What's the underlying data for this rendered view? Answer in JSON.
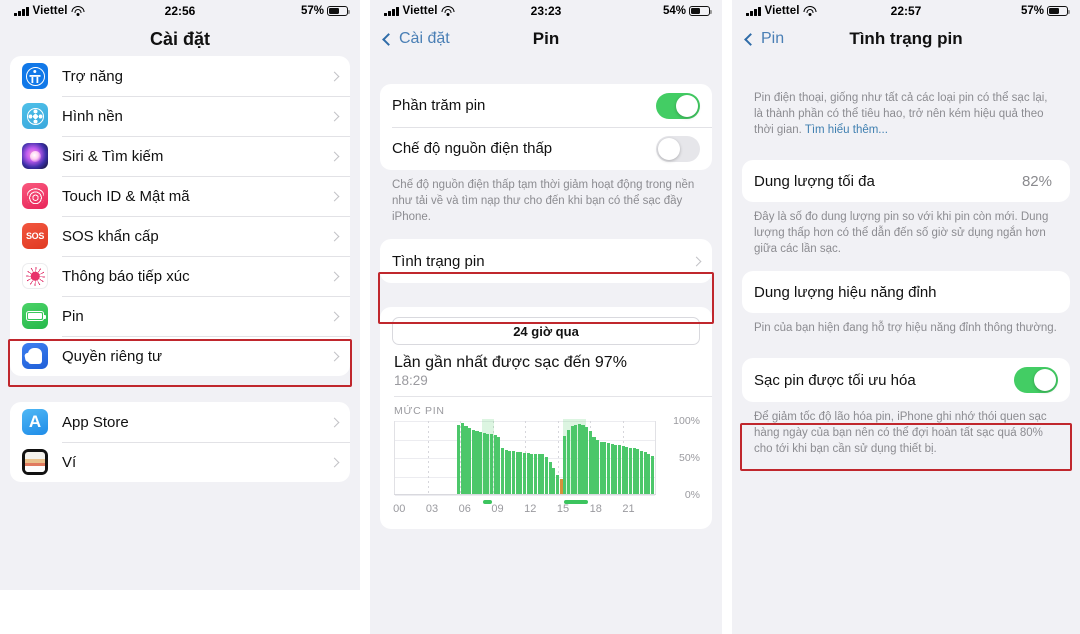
{
  "panel1": {
    "status": {
      "carrier": "Viettel",
      "time": "22:56",
      "battery_pct": "57%",
      "signal_icon": "signal-bars-icon",
      "wifi_icon": "wifi-icon",
      "battery_icon": "battery-icon"
    },
    "nav": {
      "title": "Cài đặt"
    },
    "group1": [
      {
        "label": "Trợ năng",
        "icon": "accessibility-icon"
      },
      {
        "label": "Hình nền",
        "icon": "wallpaper-icon"
      },
      {
        "label": "Siri & Tìm kiếm",
        "icon": "siri-icon"
      },
      {
        "label": "Touch ID & Mật mã",
        "icon": "touchid-icon"
      },
      {
        "label": "SOS khẩn cấp",
        "icon": "sos-icon"
      },
      {
        "label": "Thông báo tiếp xúc",
        "icon": "exposure-notification-icon"
      },
      {
        "label": "Pin",
        "icon": "battery-icon"
      },
      {
        "label": "Quyền riêng tư",
        "icon": "privacy-hand-icon"
      }
    ],
    "group2": [
      {
        "label": "App Store",
        "icon": "app-store-icon"
      },
      {
        "label": "Ví",
        "icon": "wallet-icon"
      }
    ],
    "highlight_row": "Pin"
  },
  "panel2": {
    "status": {
      "carrier": "Viettel",
      "time": "23:23",
      "battery_pct": "54%"
    },
    "nav": {
      "back": "Cài đặt",
      "title": "Pin"
    },
    "toggles": [
      {
        "label": "Phần trăm pin",
        "state": "on"
      },
      {
        "label": "Chế độ nguồn điện thấp",
        "state": "off"
      }
    ],
    "footnote": "Chế độ nguồn điện thấp tạm thời giảm hoạt động trong nền như tải về và tìm nạp thư cho đến khi bạn có thể sạc đầy iPhone.",
    "battery_health_row": "Tình trạng pin",
    "segment_label": "24 giờ qua",
    "last_charge_title": "Lần gần nhất được sạc đến 97%",
    "last_charge_time": "18:29",
    "chart_header": "MỨC PIN"
  },
  "panel3": {
    "status": {
      "carrier": "Viettel",
      "time": "22:57",
      "battery_pct": "57%"
    },
    "nav": {
      "back": "Pin",
      "title": "Tình trạng pin"
    },
    "intro": "Pin điện thoại, giống như tất cả các loại pin có thể sạc lại, là thành phần có thể tiêu hao, trở nên kém hiệu quả theo thời gian. ",
    "intro_link": "Tìm hiểu thêm...",
    "max_capacity": {
      "label": "Dung lượng tối đa",
      "value": "82%"
    },
    "max_capacity_note": "Đây là số đo dung lượng pin so với khi pin còn mới. Dung lượng thấp hơn có thể dẫn đến số giờ sử dụng ngắn hơn giữa các lần sạc.",
    "peak_performance": {
      "label": "Dung lượng hiệu năng đỉnh"
    },
    "peak_performance_note": "Pin của bạn hiện đang hỗ trợ hiệu năng đỉnh thông thường.",
    "optimized_charging": {
      "label": "Sạc pin được tối ưu hóa",
      "state": "on"
    },
    "optimized_charging_note": "Để giảm tốc độ lão hóa pin, iPhone ghi nhớ thói quen sạc hàng ngày của bạn nên có thể đợi hoàn tất sạc quá 80% cho tới khi bạn cần sử dụng thiết bị."
  },
  "colors": {
    "accent_green": "#43cd64",
    "highlight_red": "#c0272d",
    "link_blue": "#3f7fb0",
    "panel_bg": "#f1f1f5"
  },
  "chart_data": {
    "type": "bar",
    "title": "MỨC PIN",
    "xlabel": "",
    "ylabel": "",
    "ylim": [
      0,
      100
    ],
    "ytick_labels": [
      "100%",
      "50%",
      "0%"
    ],
    "xtick_labels": [
      "00",
      "03",
      "06",
      "09",
      "12",
      "15",
      "18",
      "21"
    ],
    "grid": true,
    "legend": null,
    "series": [
      {
        "name": "Mức pin",
        "color": "#4cc76a",
        "values": [
          0,
          0,
          0,
          0,
          0,
          0,
          0,
          0,
          0,
          0,
          0,
          0,
          0,
          0,
          0,
          0,
          0,
          95,
          97,
          93,
          90,
          88,
          87,
          85,
          84,
          83,
          82,
          81,
          79,
          63,
          61,
          60,
          59,
          58,
          58,
          57,
          57,
          56,
          56,
          56,
          55,
          52,
          44,
          36,
          27,
          22,
          80,
          88,
          93,
          95,
          96,
          95,
          92,
          86,
          78,
          74,
          72,
          71,
          70,
          69,
          68,
          67,
          66,
          65,
          64,
          63,
          62,
          60,
          58,
          55,
          53
        ],
        "bar_colors_override": {
          "45": "#d6913c"
        }
      }
    ],
    "charging_bands": [
      {
        "start_hour": 8.2,
        "end_hour": 9.0
      },
      {
        "start_hour": 15.8,
        "end_hour": 17.8
      }
    ]
  }
}
